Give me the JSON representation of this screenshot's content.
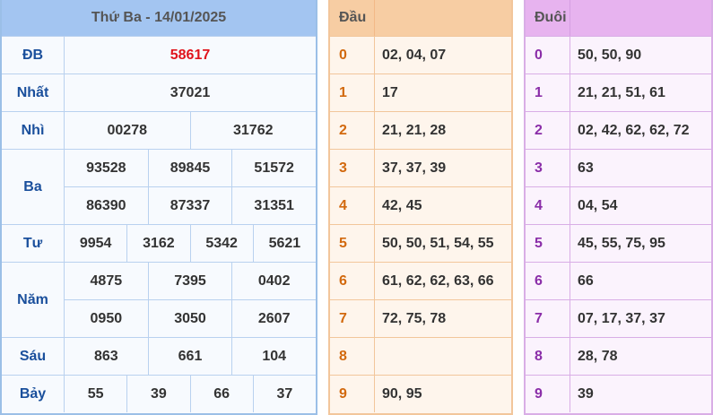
{
  "results": {
    "header": "Thứ Ba - 14/01/2025",
    "prizes": [
      {
        "label": "ĐB",
        "rows": [
          [
            "58617"
          ]
        ]
      },
      {
        "label": "Nhất",
        "rows": [
          [
            "37021"
          ]
        ]
      },
      {
        "label": "Nhì",
        "rows": [
          [
            "00278",
            "31762"
          ]
        ]
      },
      {
        "label": "Ba",
        "rows": [
          [
            "93528",
            "89845",
            "51572"
          ],
          [
            "86390",
            "87337",
            "31351"
          ]
        ]
      },
      {
        "label": "Tư",
        "rows": [
          [
            "9954",
            "3162",
            "5342",
            "5621"
          ]
        ]
      },
      {
        "label": "Năm",
        "rows": [
          [
            "4875",
            "7395",
            "0402"
          ],
          [
            "0950",
            "3050",
            "2607"
          ]
        ]
      },
      {
        "label": "Sáu",
        "rows": [
          [
            "863",
            "661",
            "104"
          ]
        ]
      },
      {
        "label": "Bảy",
        "rows": [
          [
            "55",
            "39",
            "66",
            "37"
          ]
        ]
      }
    ]
  },
  "dau": {
    "header": "Đầu",
    "rows": [
      {
        "k": "0",
        "v": "02, 04, 07"
      },
      {
        "k": "1",
        "v": "17"
      },
      {
        "k": "2",
        "v": "21, 21, 28"
      },
      {
        "k": "3",
        "v": "37, 37, 39"
      },
      {
        "k": "4",
        "v": "42, 45"
      },
      {
        "k": "5",
        "v": "50, 50, 51, 54, 55"
      },
      {
        "k": "6",
        "v": "61, 62, 62, 63, 66"
      },
      {
        "k": "7",
        "v": "72, 75, 78"
      },
      {
        "k": "8",
        "v": ""
      },
      {
        "k": "9",
        "v": "90, 95"
      }
    ]
  },
  "duoi": {
    "header": "Đuôi",
    "rows": [
      {
        "k": "0",
        "v": "50, 50, 90"
      },
      {
        "k": "1",
        "v": "21, 21, 51, 61"
      },
      {
        "k": "2",
        "v": "02, 42, 62, 62, 72"
      },
      {
        "k": "3",
        "v": "63"
      },
      {
        "k": "4",
        "v": "04, 54"
      },
      {
        "k": "5",
        "v": "45, 55, 75, 95"
      },
      {
        "k": "6",
        "v": "66"
      },
      {
        "k": "7",
        "v": "07, 17, 37, 37"
      },
      {
        "k": "8",
        "v": "28, 78"
      },
      {
        "k": "9",
        "v": "39"
      }
    ]
  },
  "colors": {
    "special_prize": "#e0141d",
    "results_header": "#a3c5f1",
    "dau_header": "#f7cda3",
    "duoi_header": "#e7b3ef"
  }
}
